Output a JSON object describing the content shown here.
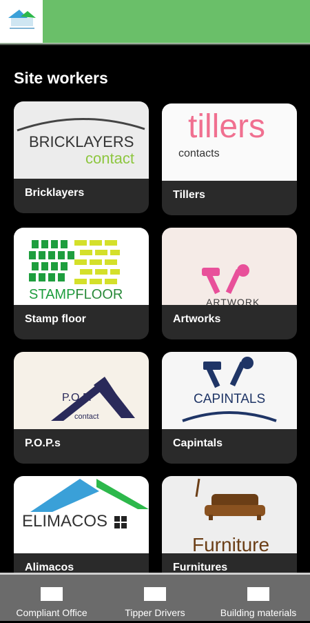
{
  "section_title": "Site workers",
  "cards": [
    {
      "label": "Bricklayers",
      "logo_line1": "BRICKLAYERS",
      "logo_line2": "contact"
    },
    {
      "label": "Tillers",
      "logo_line1": "tillers",
      "logo_line2": "contacts"
    },
    {
      "label": "Stamp floor",
      "logo_line1": "STAMP",
      "logo_line2": "FLOOR"
    },
    {
      "label": "Artworks",
      "logo_line1": "ARTWORK"
    },
    {
      "label": "P.O.P.s",
      "logo_line1": "P.O.P.",
      "logo_line2": "contact"
    },
    {
      "label": "Capintals",
      "logo_line1": "CAPINTALS"
    },
    {
      "label": "Alimacos",
      "logo_line1": "ELIMACOS"
    },
    {
      "label": "Furnitures",
      "logo_line1": "Furniture"
    }
  ],
  "bottom_nav": [
    {
      "label": "Compliant Office"
    },
    {
      "label": "Tipper Drivers"
    },
    {
      "label": "Building materials"
    }
  ],
  "colors": {
    "top_bar": "#6abf69",
    "background": "#000000",
    "card_footer": "#2a2a2a",
    "bottom_nav": "#6b6b6b",
    "accent_green": "#8dc63f",
    "tillers_pink": "#f07090",
    "capintals_navy": "#1f3566",
    "roof_green": "#2db84b",
    "roof_blue": "#3aa0d8",
    "furniture_brown": "#6b3e16"
  },
  "icons": [
    "app-logo-icon",
    "office-icon",
    "tipper-icon",
    "materials-icon",
    "hammer-wrench-icon",
    "roof-icon",
    "sofa-icon"
  ]
}
